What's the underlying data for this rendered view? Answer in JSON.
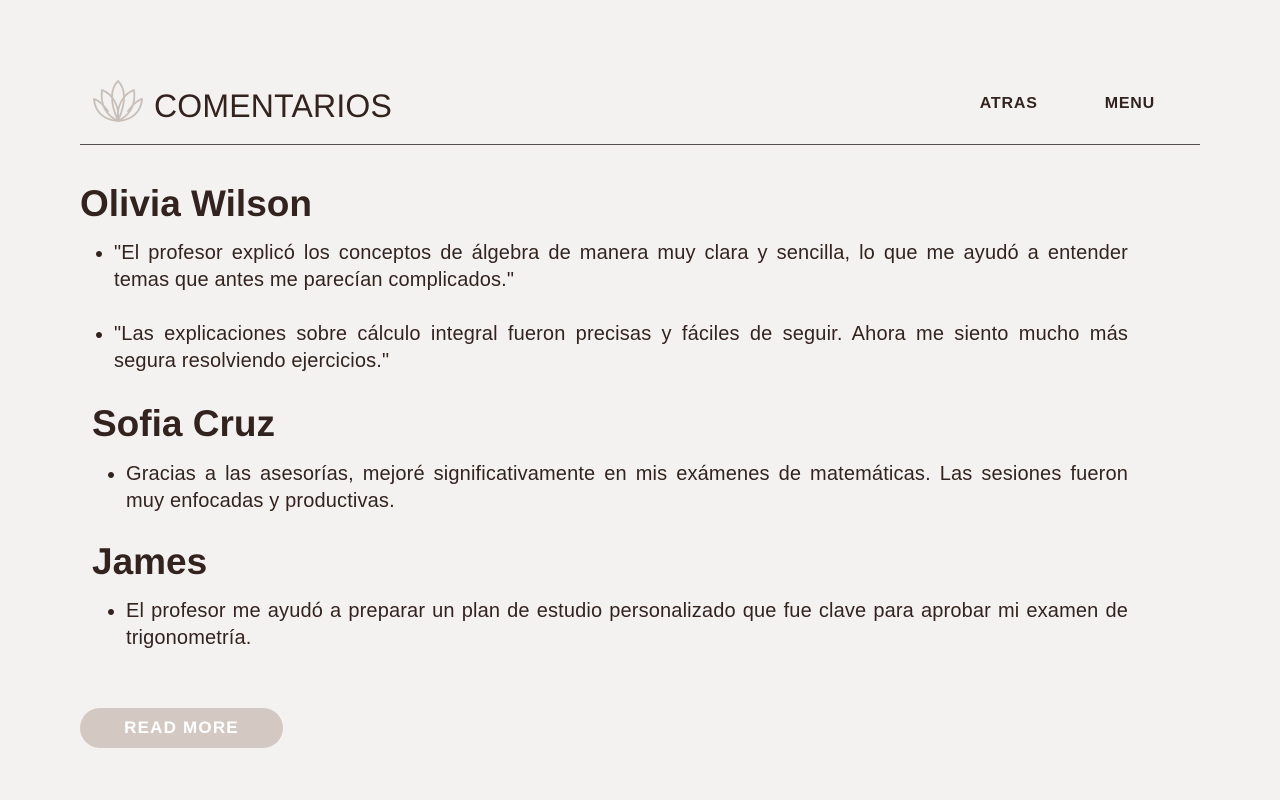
{
  "header": {
    "title": "COMENTARIOS",
    "logo_icon": "lotus-icon",
    "nav": {
      "back_label": "ATRAS",
      "menu_label": "MENU"
    }
  },
  "testimonials": [
    {
      "name": "Olivia Wilson",
      "comments": [
        "\"El profesor explicó los conceptos de álgebra de manera muy clara y sencilla, lo que me ayudó a entender temas que antes me parecían complicados.\"",
        "\"Las explicaciones sobre cálculo integral fueron precisas y fáciles de seguir. Ahora me siento mucho más segura resolviendo ejercicios.\""
      ]
    },
    {
      "name": "Sofia Cruz",
      "comments": [
        "Gracias a las asesorías, mejoré significativamente en mis exámenes de matemáticas. Las sesiones fueron muy enfocadas y productivas."
      ]
    },
    {
      "name": "James",
      "comments": [
        "El profesor me ayudó a preparar un plan de estudio personalizado que fue clave para aprobar mi examen de trigonometría."
      ]
    }
  ],
  "read_more_label": "READ MORE",
  "colors": {
    "background": "#f4f2f0",
    "text": "#33231f",
    "button": "#d3c8c2",
    "logo": "#c9bfb9"
  }
}
